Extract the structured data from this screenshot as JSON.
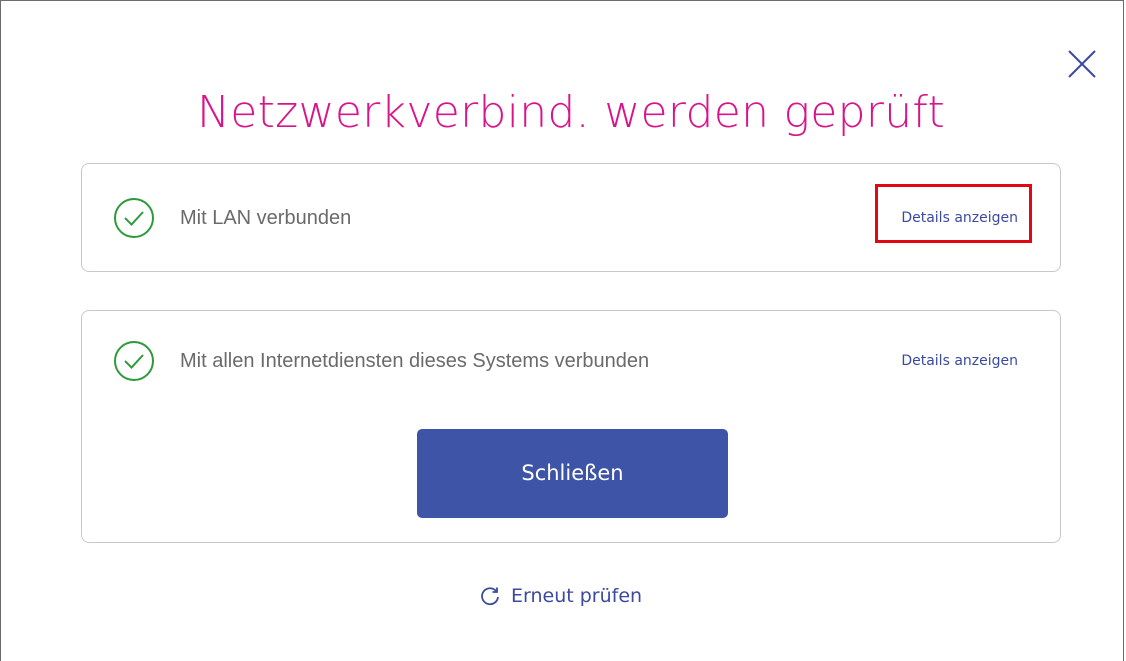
{
  "dialog": {
    "title": "Netzwerkverbind. werden geprüft",
    "close_icon": "close-icon"
  },
  "checks": [
    {
      "status": "ok",
      "icon": "check-circle-icon",
      "text": "Mit LAN verbunden",
      "details_label": "Details anzeigen"
    },
    {
      "status": "ok",
      "icon": "check-circle-icon",
      "text": "Mit allen Internetdiensten dieses Systems verbunden",
      "details_label": "Details anzeigen"
    }
  ],
  "actions": {
    "close_label": "Schließen",
    "retry_label": "Erneut prüfen",
    "retry_icon": "refresh-icon"
  },
  "colors": {
    "title": "#d9138a",
    "check": "#2e9a3a",
    "link": "#3b4aa0",
    "primary_button": "#3d54a7",
    "highlight": "#e30613"
  }
}
